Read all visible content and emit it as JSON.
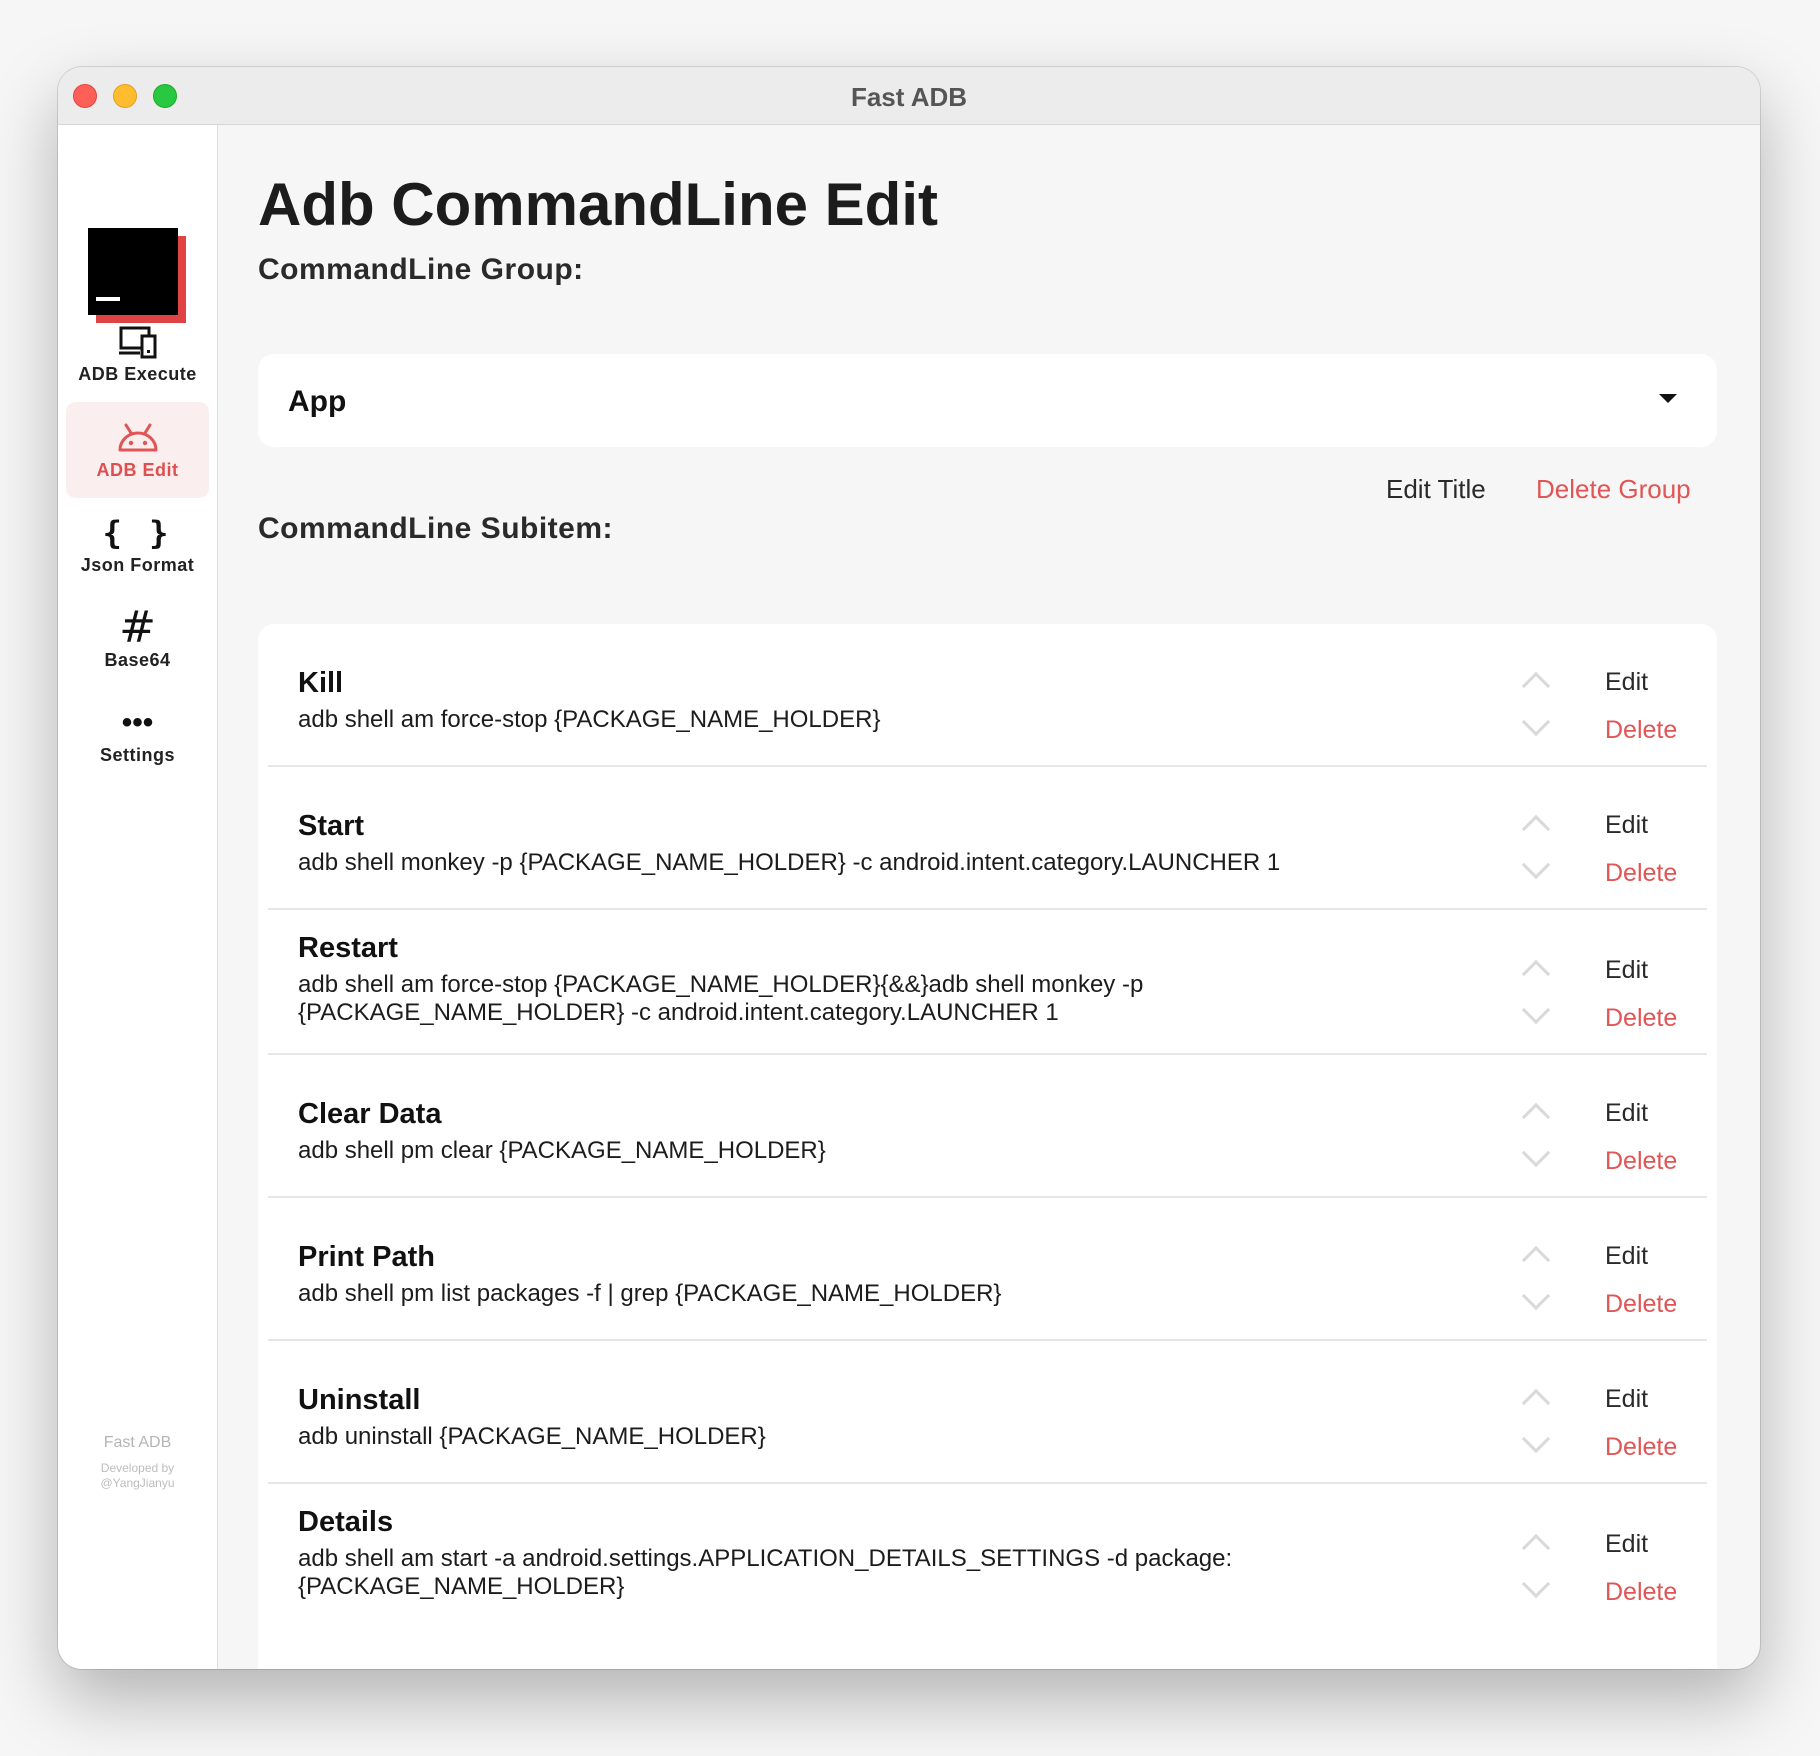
{
  "window": {
    "title": "Fast ADB"
  },
  "sidebar": {
    "items": [
      {
        "label": "ADB Execute",
        "icon": "devices-icon",
        "active": false
      },
      {
        "label": "ADB Edit",
        "icon": "android-icon",
        "active": true
      },
      {
        "label": "Json Format",
        "icon": "braces-icon",
        "glyph": "{ }",
        "active": false
      },
      {
        "label": "Base64",
        "icon": "hash-icon",
        "glyph": "#",
        "active": false
      },
      {
        "label": "Settings",
        "icon": "more-icon",
        "glyph": "•••",
        "active": false
      }
    ],
    "footer": {
      "app_name": "Fast ADB",
      "developed_by": "Developed by",
      "author": "@YangJianyu"
    }
  },
  "main": {
    "title": "Adb CommandLine Edit",
    "group_label": "CommandLine Group:",
    "group_selected": "App",
    "edit_title_label": "Edit Title",
    "delete_group_label": "Delete Group",
    "subitem_label": "CommandLine Subitem:",
    "subitems": [
      {
        "title": "Kill",
        "command": "adb shell am force-stop {PACKAGE_NAME_HOLDER}",
        "edit": "Edit",
        "delete": "Delete"
      },
      {
        "title": "Start",
        "command": "adb shell monkey -p {PACKAGE_NAME_HOLDER} -c android.intent.category.LAUNCHER 1",
        "edit": "Edit",
        "delete": "Delete"
      },
      {
        "title": "Restart",
        "command_line1": "adb shell am force-stop {PACKAGE_NAME_HOLDER}{&&}adb shell monkey -p",
        "command_line2": "{PACKAGE_NAME_HOLDER} -c android.intent.category.LAUNCHER 1",
        "edit": "Edit",
        "delete": "Delete"
      },
      {
        "title": "Clear Data",
        "command": "adb shell pm clear {PACKAGE_NAME_HOLDER}",
        "edit": "Edit",
        "delete": "Delete"
      },
      {
        "title": "Print Path",
        "command": "adb shell pm list packages -f | grep {PACKAGE_NAME_HOLDER}",
        "edit": "Edit",
        "delete": "Delete"
      },
      {
        "title": "Uninstall",
        "command": "adb uninstall {PACKAGE_NAME_HOLDER}",
        "edit": "Edit",
        "delete": "Delete"
      },
      {
        "title": "Details",
        "command_line1": "adb shell am start -a android.settings.APPLICATION_DETAILS_SETTINGS -d package:",
        "command_line2": "{PACKAGE_NAME_HOLDER}",
        "edit": "Edit",
        "delete": "Delete"
      }
    ]
  },
  "colors": {
    "accent": "#e05555",
    "active_bg": "#fbeeee",
    "logo_red": "#e04343"
  }
}
